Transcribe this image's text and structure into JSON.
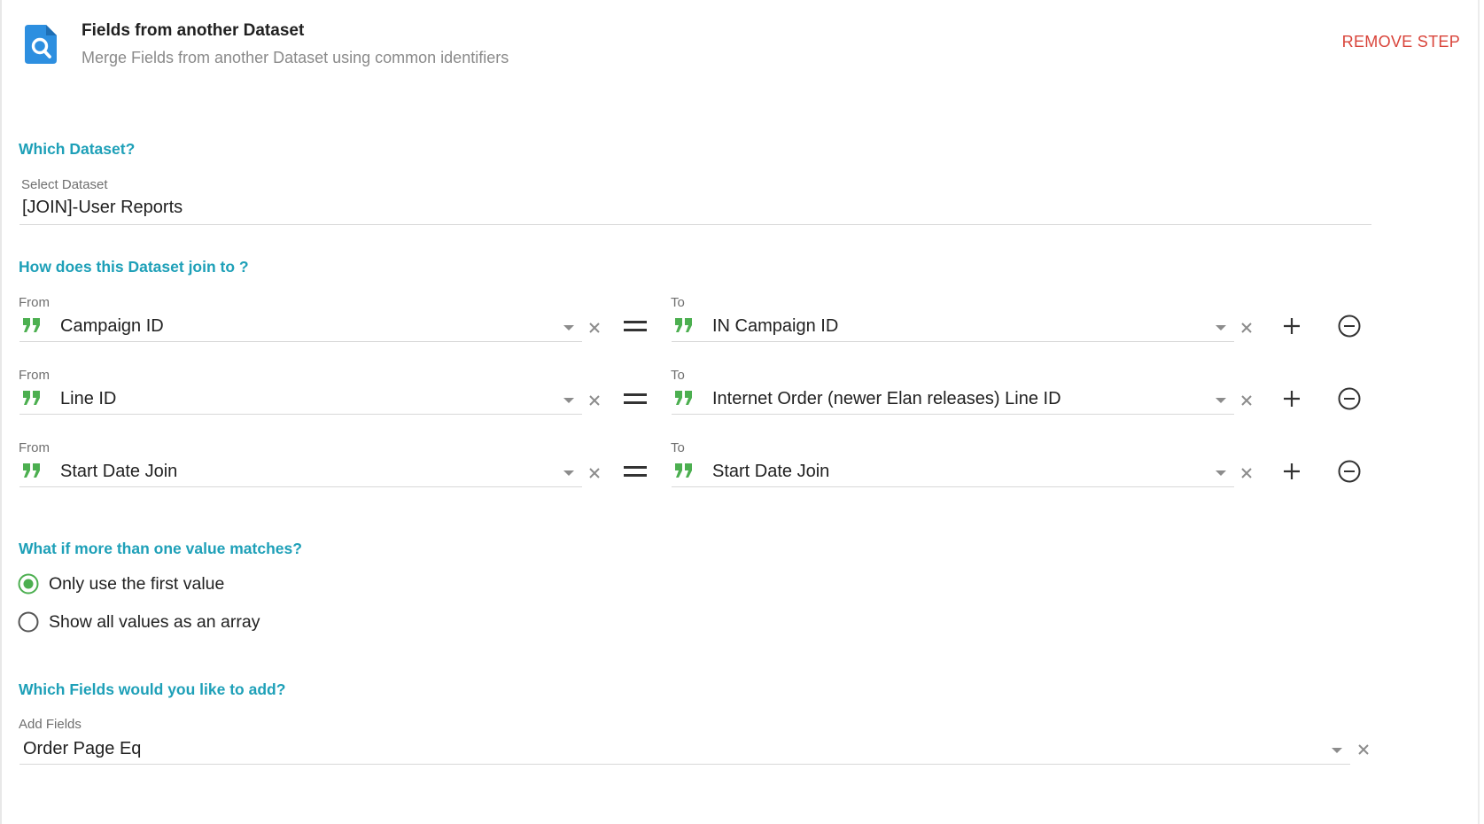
{
  "header": {
    "title": "Fields from another Dataset",
    "subtitle": "Merge Fields from another Dataset using common identifiers",
    "remove_step_label": "REMOVE STEP",
    "icon": "dataset-search-icon"
  },
  "dataset_section": {
    "heading": "Which Dataset?",
    "select_label": "Select Dataset",
    "select_value": "[JOIN]-User Reports"
  },
  "join_section": {
    "heading": "How does this Dataset join to ?",
    "rows": [
      {
        "from_label": "From",
        "from_value": "Campaign ID",
        "to_label": "To",
        "to_value": "IN Campaign ID"
      },
      {
        "from_label": "From",
        "from_value": "Line ID",
        "to_label": "To",
        "to_value": "Internet Order (newer Elan releases) Line ID"
      },
      {
        "from_label": "From",
        "from_value": "Start Date Join",
        "to_label": "To",
        "to_value": "Start Date Join"
      }
    ]
  },
  "match_section": {
    "heading": "What if more than one value matches?",
    "options": [
      {
        "label": "Only use the first value",
        "selected": true
      },
      {
        "label": "Show all values as an array",
        "selected": false
      }
    ]
  },
  "fields_section": {
    "heading": "Which Fields would you like to add?",
    "add_label": "Add Fields",
    "add_value": "Order Page Eq"
  },
  "colors": {
    "accent": "#1ea0b8",
    "remove": "#d9443a",
    "quote_icon": "#4caf50",
    "radio_selected": "#4caf50",
    "icon_blue": "#2d8fe0"
  }
}
